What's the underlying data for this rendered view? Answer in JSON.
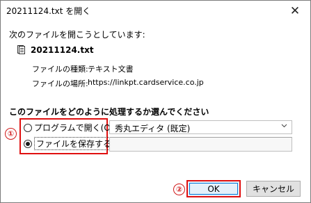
{
  "window": {
    "title": "20211124.txt を開く",
    "close_glyph": "✕"
  },
  "dialog": {
    "heading": "次のファイルを開こうとしています:",
    "file_name": "20211124.txt",
    "type_label": "ファイルの種類:",
    "type_value": "テキスト文書",
    "location_label": "ファイルの場所:",
    "location_value": "https://linkpt.cardservice.co.jp",
    "section_title": "このファイルをどのように処理するか選んでください"
  },
  "options": {
    "open_with_label": "プログラムで開く(O):",
    "open_with_selected": false,
    "save_label": "ファイルを保存する(S)",
    "save_selected": true,
    "program_select_value": "秀丸エディタ (既定)"
  },
  "annotations": {
    "badge_1": "①",
    "badge_2": "②",
    "highlight_color": "#e01010"
  },
  "buttons": {
    "ok_label": "OK",
    "cancel_label": "キャンセル"
  },
  "icons": {
    "file": "document-icon",
    "close": "close-icon",
    "dropdown": "chevron-down-icon"
  }
}
